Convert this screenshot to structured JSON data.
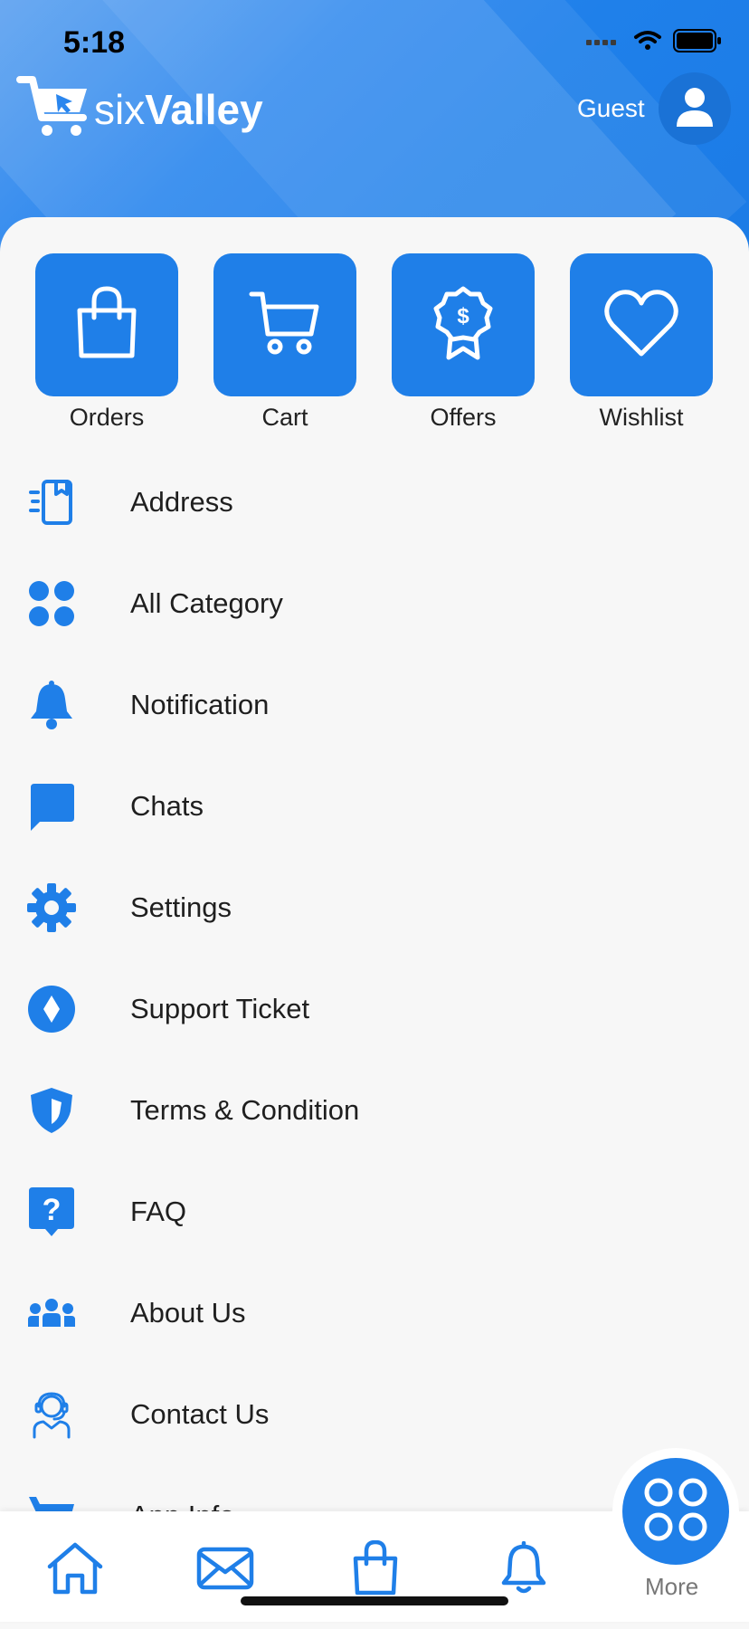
{
  "status_bar": {
    "time": "5:18"
  },
  "brand": {
    "name_part1": "six",
    "name_part2": "Valley"
  },
  "header": {
    "user_label": "Guest"
  },
  "quick_actions": [
    {
      "label": "Orders",
      "icon": "bag-icon"
    },
    {
      "label": "Cart",
      "icon": "cart-icon"
    },
    {
      "label": "Offers",
      "icon": "offer-badge-icon"
    },
    {
      "label": "Wishlist",
      "icon": "heart-icon"
    }
  ],
  "menu": [
    {
      "label": "Address",
      "icon": "address-book-icon"
    },
    {
      "label": "All Category",
      "icon": "grid-dots-icon"
    },
    {
      "label": "Notification",
      "icon": "bell-icon"
    },
    {
      "label": "Chats",
      "icon": "chat-bubble-icon"
    },
    {
      "label": "Settings",
      "icon": "gear-icon"
    },
    {
      "label": "Support Ticket",
      "icon": "diamond-circle-icon"
    },
    {
      "label": "Terms & Condition",
      "icon": "shield-icon"
    },
    {
      "label": "FAQ",
      "icon": "question-icon"
    },
    {
      "label": "About Us",
      "icon": "team-icon"
    },
    {
      "label": "Contact Us",
      "icon": "support-agent-icon"
    },
    {
      "label": "App Info",
      "icon": "cart-icon"
    }
  ],
  "bottom_nav": {
    "items": [
      "home-icon",
      "mail-icon",
      "bag-icon",
      "bell-icon"
    ],
    "more_label": "More"
  },
  "colors": {
    "primary": "#1f7fe8",
    "background": "#f7f7f7",
    "text": "#1f1f1f"
  }
}
